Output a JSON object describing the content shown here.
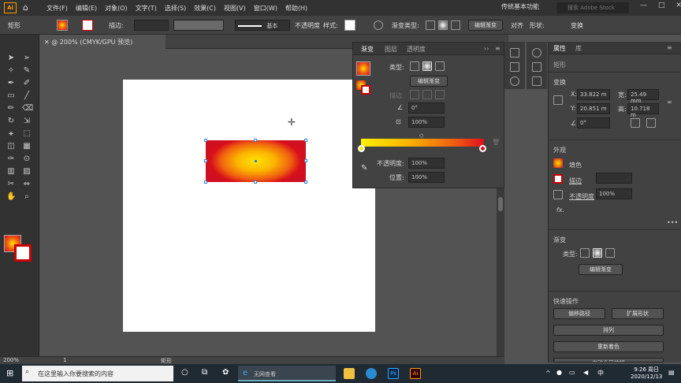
{
  "app": {
    "logo_text": "Ai",
    "menu": [
      "文件(F)",
      "编辑(E)",
      "对象(O)",
      "文字(T)",
      "选择(S)",
      "效果(C)",
      "视图(V)",
      "窗口(W)",
      "帮助(H)"
    ],
    "workspace": "传统基本功能",
    "search_placeholder": "搜索 Adobe Stock"
  },
  "control_bar": {
    "object_type": "矩形",
    "stroke_label": "描边:",
    "stroke_style": "基本",
    "opacity_label": "不透明度",
    "style_label": "样式:",
    "gradient_type_label": "渐变类型:",
    "edit_gradient": "编辑渐变",
    "align": "对齐",
    "shape": "形状:",
    "transform": "变换"
  },
  "document": {
    "tab_title": "@ 200% (CMYK/GPU 预览)",
    "zoom": "200%",
    "page": "1",
    "tool_name": "矩形"
  },
  "gradient_panel": {
    "tabs": [
      "渐变",
      "图层",
      "透明度"
    ],
    "type_label": "类型:",
    "edit_button": "编辑渐变",
    "stroke_label": "描边",
    "angle_value": "0°",
    "aspect_value": "100%",
    "opacity_label": "不透明度:",
    "opacity_value": "100%",
    "location_label": "位置:",
    "location_value": "100%"
  },
  "properties": {
    "tabs": [
      "属性",
      "库"
    ],
    "object": "矩形",
    "transform_title": "变换",
    "x_label": "X:",
    "x_value": "33.822 m",
    "y_label": "Y:",
    "y_value": "20.851 m",
    "w_label": "宽:",
    "w_value": "25.49 mm",
    "h_label": "高:",
    "h_value": "10.718 m",
    "angle_value": "0°",
    "appearance_title": "外观",
    "fill_label": "填色",
    "stroke_label": "描边",
    "opacity_label": "不透明度",
    "opacity_value": "100%",
    "fx_label": "fx.",
    "gradient_title": "渐变",
    "gradient_type_label": "类型:",
    "edit_gradient": "编辑渐变",
    "quick_actions_title": "快速操作",
    "offset_path": "偏移路径",
    "expand_shape": "扩展形状",
    "arrange": "排列",
    "recolor": "重新着色",
    "auto_select": "启动全局编辑"
  },
  "taskbar": {
    "search_text": "在这里输入你要搜索的内容",
    "browser_text": "无网查看",
    "time": "9:26 周日",
    "date": "2020/12/13"
  },
  "colors": {
    "accent": "#ff9a00",
    "panel_bg": "#424242",
    "gradient_start": "#ffe400",
    "gradient_end": "#d01020"
  }
}
